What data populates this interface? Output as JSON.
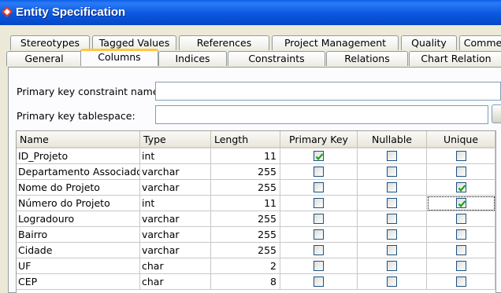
{
  "window": {
    "title": "Entity Specification",
    "accent": "#0a57e0"
  },
  "tabs_back": [
    {
      "label": "Stereotypes"
    },
    {
      "label": "Tagged Values"
    },
    {
      "label": "References"
    },
    {
      "label": "Project Management"
    },
    {
      "label": "Quality"
    },
    {
      "label": "Comme"
    }
  ],
  "tabs_front": [
    {
      "label": "General"
    },
    {
      "label": "Columns",
      "active": true
    },
    {
      "label": "Indices"
    },
    {
      "label": "Constraints"
    },
    {
      "label": "Relations"
    },
    {
      "label": "Chart Relation"
    }
  ],
  "form": {
    "pk_constraint_label": "Primary key constraint name:",
    "pk_constraint_value": "",
    "pk_tablespace_label": "Primary key tablespace:",
    "pk_tablespace_value": ""
  },
  "grid": {
    "headers": [
      "Name",
      "Type",
      "Length",
      "Primary Key",
      "Nullable",
      "Unique"
    ],
    "rows": [
      {
        "name": "ID_Projeto",
        "type": "int",
        "length": "11",
        "pk": true,
        "nullable": false,
        "unique": false
      },
      {
        "name": "Departamento Associado",
        "type": "varchar",
        "length": "255",
        "pk": false,
        "nullable": false,
        "unique": false
      },
      {
        "name": "Nome do Projeto",
        "type": "varchar",
        "length": "255",
        "pk": false,
        "nullable": false,
        "unique": true
      },
      {
        "name": "Número do Projeto",
        "type": "int",
        "length": "11",
        "pk": false,
        "nullable": false,
        "unique": true
      },
      {
        "name": "Logradouro",
        "type": "varchar",
        "length": "255",
        "pk": false,
        "nullable": false,
        "unique": false
      },
      {
        "name": "Bairro",
        "type": "varchar",
        "length": "255",
        "pk": false,
        "nullable": false,
        "unique": false
      },
      {
        "name": "Cidade",
        "type": "varchar",
        "length": "255",
        "pk": false,
        "nullable": false,
        "unique": false
      },
      {
        "name": "UF",
        "type": "char",
        "length": "2",
        "pk": false,
        "nullable": false,
        "unique": false
      },
      {
        "name": "CEP",
        "type": "char",
        "length": "8",
        "pk": false,
        "nullable": false,
        "unique": false
      }
    ]
  }
}
